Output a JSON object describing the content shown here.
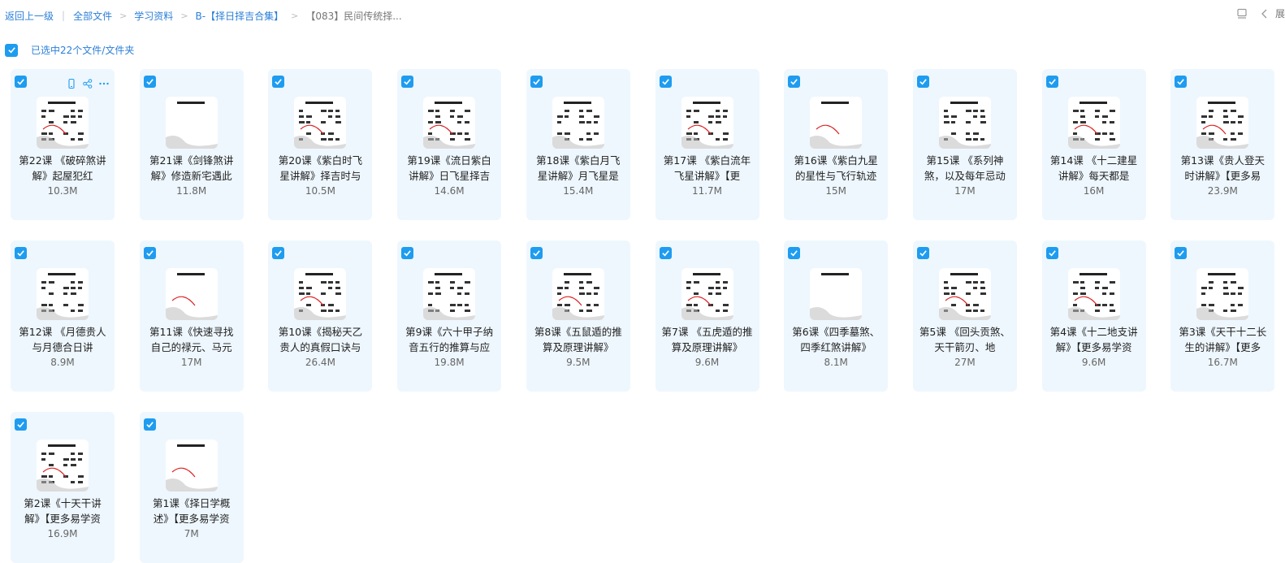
{
  "breadcrumb": {
    "back": "返回上一级",
    "items": [
      "全部文件",
      "学习资料",
      "B-【择日择吉合集】"
    ],
    "current": "【083】民间传统择..."
  },
  "toolbar": {
    "expand_label": "展"
  },
  "selection": {
    "text": "已选中22个文件/文件夹"
  },
  "colors": {
    "accent": "#1e9cf0",
    "card_bg": "#eef7fe",
    "link": "#2b7fd8"
  },
  "files": [
    {
      "name": "第22课 《破碎煞讲解》起屋犯红",
      "size": "10.3M"
    },
    {
      "name": "第21课《剑锋煞讲解》修造新宅遇此",
      "size": "11.8M"
    },
    {
      "name": "第20课《紫白时飞星讲解》择吉时与",
      "size": "10.5M"
    },
    {
      "name": "第19课《流日紫白讲解》日飞星择吉",
      "size": "14.6M"
    },
    {
      "name": "第18课《紫白月飞星讲解》月飞星是",
      "size": "15.4M"
    },
    {
      "name": "第17课 《紫白流年飞星讲解》【更",
      "size": "11.7M"
    },
    {
      "name": "第16课《紫白九星的星性与飞行轨迹",
      "size": "15M"
    },
    {
      "name": "第15课 《系列神煞，以及每年忌动",
      "size": "17M"
    },
    {
      "name": "第14课 《十二建星讲解》每天都是",
      "size": "16M"
    },
    {
      "name": "第13课《贵人登天时讲解》【更多易",
      "size": "23.9M"
    },
    {
      "name": "第12课 《月德贵人与月德合日讲",
      "size": "8.9M"
    },
    {
      "name": "第11课《快速寻找自己的禄元、马元",
      "size": "17M"
    },
    {
      "name": "第10课《揭秘天乙贵人的真假口诀与",
      "size": "26.4M"
    },
    {
      "name": "第9课《六十甲子纳音五行的推算与应",
      "size": "19.8M"
    },
    {
      "name": "第8课《五鼠遁的推算及原理讲解》",
      "size": "9.5M"
    },
    {
      "name": "第7课 《五虎遁的推算及原理讲解》",
      "size": "9.6M"
    },
    {
      "name": "第6课《四季墓煞、四季红煞讲解》",
      "size": "8.1M"
    },
    {
      "name": "第5课 《回头贡煞、天干箭刃、地",
      "size": "27M"
    },
    {
      "name": "第4课《十二地支讲解》【更多易学资",
      "size": "9.6M"
    },
    {
      "name": "第3课《天干十二长生的讲解》【更多",
      "size": "16.7M"
    },
    {
      "name": "第2课《十天干讲解》【更多易学资",
      "size": "16.9M"
    },
    {
      "name": "第1课《择日学概述》【更多易学资",
      "size": "7M"
    }
  ]
}
